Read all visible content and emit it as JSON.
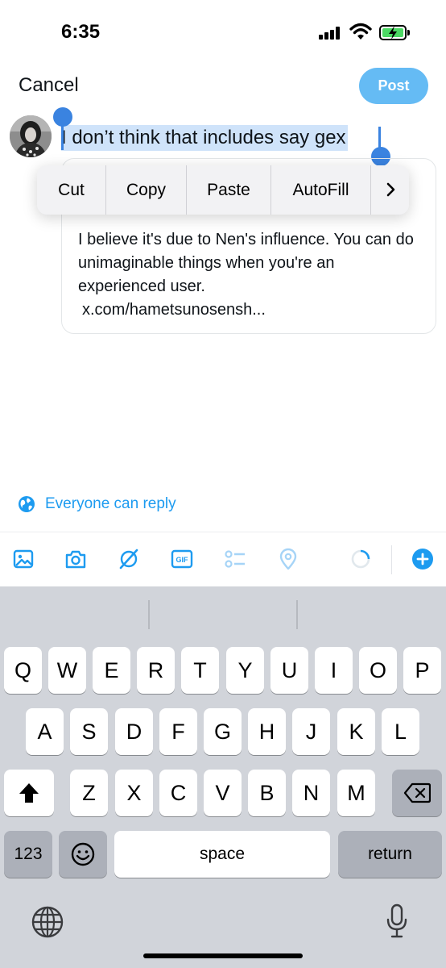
{
  "status_bar": {
    "time": "6:35"
  },
  "header": {
    "cancel_label": "Cancel",
    "post_label": "Post"
  },
  "compose": {
    "text": "I don’t think that includes say gex"
  },
  "edit_menu": {
    "items": [
      "Cut",
      "Copy",
      "Paste",
      "AutoFill"
    ],
    "more_icon": "chevron-right-icon"
  },
  "quote": {
    "text": "I believe it's due to Nen's influence. You can do unimaginable things when you're an experienced user.",
    "link": "x.com/hametsunosensh..."
  },
  "reply_setting": {
    "label": "Everyone can reply",
    "icon": "globe-icon"
  },
  "toolbar": {
    "icons": [
      "image-icon",
      "camera-icon",
      "grok-icon",
      "gif-icon",
      "poll-icon",
      "location-icon",
      "char-count-icon",
      "add-icon"
    ],
    "gif_label": "GIF"
  },
  "keyboard": {
    "row1": [
      "Q",
      "W",
      "E",
      "R",
      "T",
      "Y",
      "U",
      "I",
      "O",
      "P"
    ],
    "row2": [
      "A",
      "S",
      "D",
      "F",
      "G",
      "H",
      "J",
      "K",
      "L"
    ],
    "row3": [
      "Z",
      "X",
      "C",
      "V",
      "B",
      "N",
      "M"
    ],
    "numbers_label": "123",
    "space_label": "space",
    "return_label": "return"
  },
  "colors": {
    "accent": "#1d9bf0",
    "selection": "#cfe3fa",
    "handle": "#3a83e0",
    "keyboard_bg": "#d1d4da"
  }
}
